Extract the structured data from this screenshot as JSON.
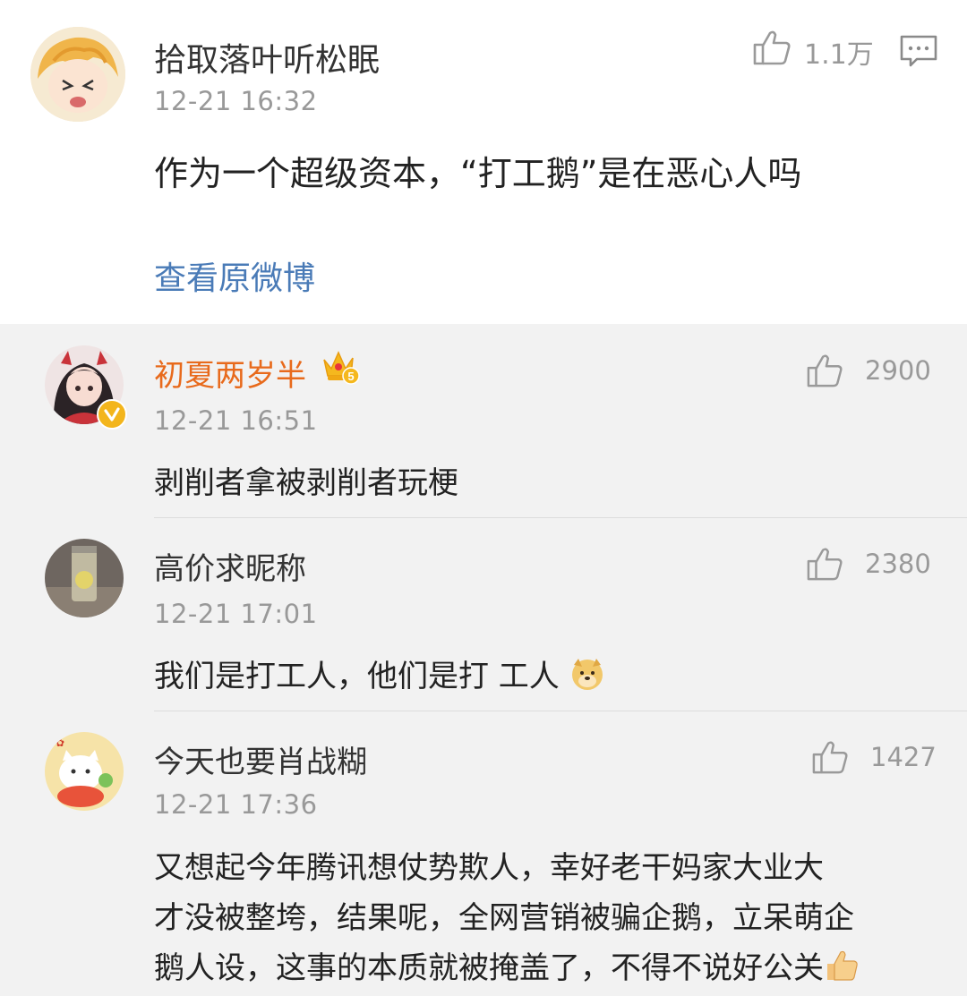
{
  "main_post": {
    "username": "拾取落叶听松眠",
    "timestamp": "12-21 16:32",
    "text": "作为一个超级资本，“打工鹅”是在恶心人吗",
    "likes": "1.1万",
    "view_original_label": "查看原微博",
    "like_icon": "thumbs-up-icon",
    "comment_icon": "comment-icon"
  },
  "replies": [
    {
      "username": "初夏两岁半",
      "badge": "vip-crown-badge",
      "badge_level": "5",
      "verified": true,
      "timestamp": "12-21 16:51",
      "text": "剥削者拿被剥削者玩梗",
      "likes": "2900",
      "name_color": "#e86a1c"
    },
    {
      "username": "高价求昵称",
      "timestamp": "12-21 17:01",
      "text": "我们是打工人，他们是打  工人",
      "text_emoji": "doge-emoji",
      "likes": "2380"
    },
    {
      "username": "今天也要肖战糊",
      "timestamp": "12-21 17:36",
      "text_lines": [
        "又想起今年腾讯想仗势欺人，幸好老干妈家大业大",
        "才没被整垮，结果呢，全网营销被骗企鹅，立呆萌企",
        "鹅人设，这事的本质就被掩盖了，不得不说好公关"
      ],
      "text_emoji": "thumbs-up-emoji",
      "likes": "1427"
    }
  ]
}
